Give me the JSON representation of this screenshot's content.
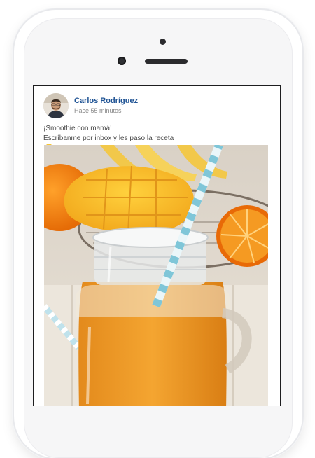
{
  "post": {
    "author_name": "Carlos Rodríguez",
    "timestamp": "Hace 55 minutos",
    "text_line_1": "¡Smoothie con mamá!",
    "text_line_2": "Escríbanme por inbox y les paso la receta",
    "emoji": "winking-face"
  },
  "colors": {
    "author_name": "#1f5394",
    "timestamp": "#8a8a8a",
    "body_text": "#4a4a4a",
    "screen_border": "#1d1d1f"
  },
  "icons": {
    "reaction_emoji": "winking-face-icon"
  }
}
